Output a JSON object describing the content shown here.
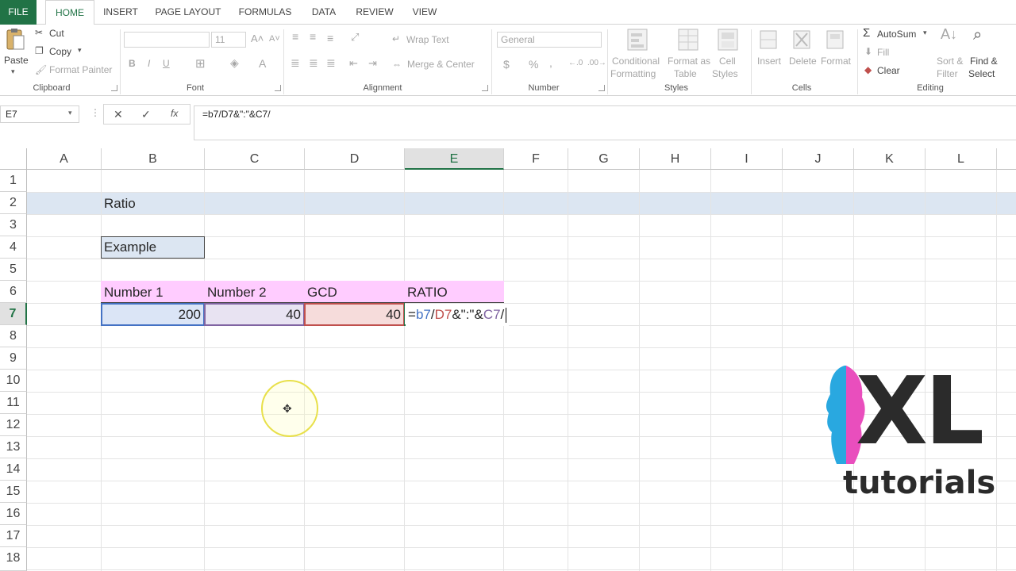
{
  "ribbon_tabs": [
    "FILE",
    "HOME",
    "INSERT",
    "PAGE LAYOUT",
    "FORMULAS",
    "DATA",
    "REVIEW",
    "VIEW"
  ],
  "clipboard": {
    "paste": "Paste",
    "cut": "Cut",
    "copy": "Copy",
    "format_painter": "Format Painter",
    "label": "Clipboard"
  },
  "font": {
    "name": "",
    "size": "11",
    "bold": "B",
    "italic": "I",
    "underline": "U",
    "label": "Font"
  },
  "alignment": {
    "wrap_text": "Wrap Text",
    "merge_center": "Merge & Center",
    "label": "Alignment"
  },
  "number": {
    "format": "General",
    "currency": "$",
    "percent": "%",
    "comma": ",",
    "label": "Number"
  },
  "styles": {
    "conditional_formatting_1": "Conditional",
    "conditional_formatting_2": "Formatting",
    "format_as_table_1": "Format as",
    "format_as_table_2": "Table",
    "cell_styles_1": "Cell",
    "cell_styles_2": "Styles",
    "label": "Styles"
  },
  "cells": {
    "insert": "Insert",
    "delete": "Delete",
    "format": "Format",
    "label": "Cells"
  },
  "editing": {
    "autosum": "AutoSum",
    "fill": "Fill",
    "clear": "Clear",
    "sort_filter_1": "Sort &",
    "sort_filter_2": "Filter",
    "find_select_1": "Find &",
    "find_select_2": "Select",
    "label": "Editing"
  },
  "formula_bar": {
    "name_box": "E7",
    "cancel": "✕",
    "enter": "✓",
    "fx": "fx",
    "formula": "=b7/D7&\":\"&C7/"
  },
  "columns": [
    "A",
    "B",
    "C",
    "D",
    "E",
    "F",
    "G",
    "H",
    "I",
    "J",
    "K",
    "L"
  ],
  "rows": [
    "1",
    "2",
    "3",
    "4",
    "5",
    "6",
    "7",
    "8",
    "9",
    "10",
    "11",
    "12",
    "13",
    "14",
    "15",
    "16",
    "17",
    "18"
  ],
  "cells_data": {
    "B2": "Ratio",
    "B4": "Example",
    "B6": "Number 1",
    "C6": "Number 2",
    "D6": "GCD",
    "E6": "RATIO",
    "B7": "200",
    "C7": "40",
    "D7": "40"
  },
  "edit_formula": {
    "eq": "=",
    "ref1": "b7",
    "op1": "/",
    "ref2": "D7",
    "mid": "&\":\"&",
    "ref3": "C7",
    "tail": "/"
  },
  "logo": {
    "big": "XL",
    "small": "tutorials"
  },
  "colors": {
    "accent": "#217346",
    "header_band": "#dce6f2",
    "table_header": "#ffccff",
    "ref_blue": "#4472c4",
    "ref_red": "#c0504d",
    "ref_purple": "#8064a2"
  }
}
